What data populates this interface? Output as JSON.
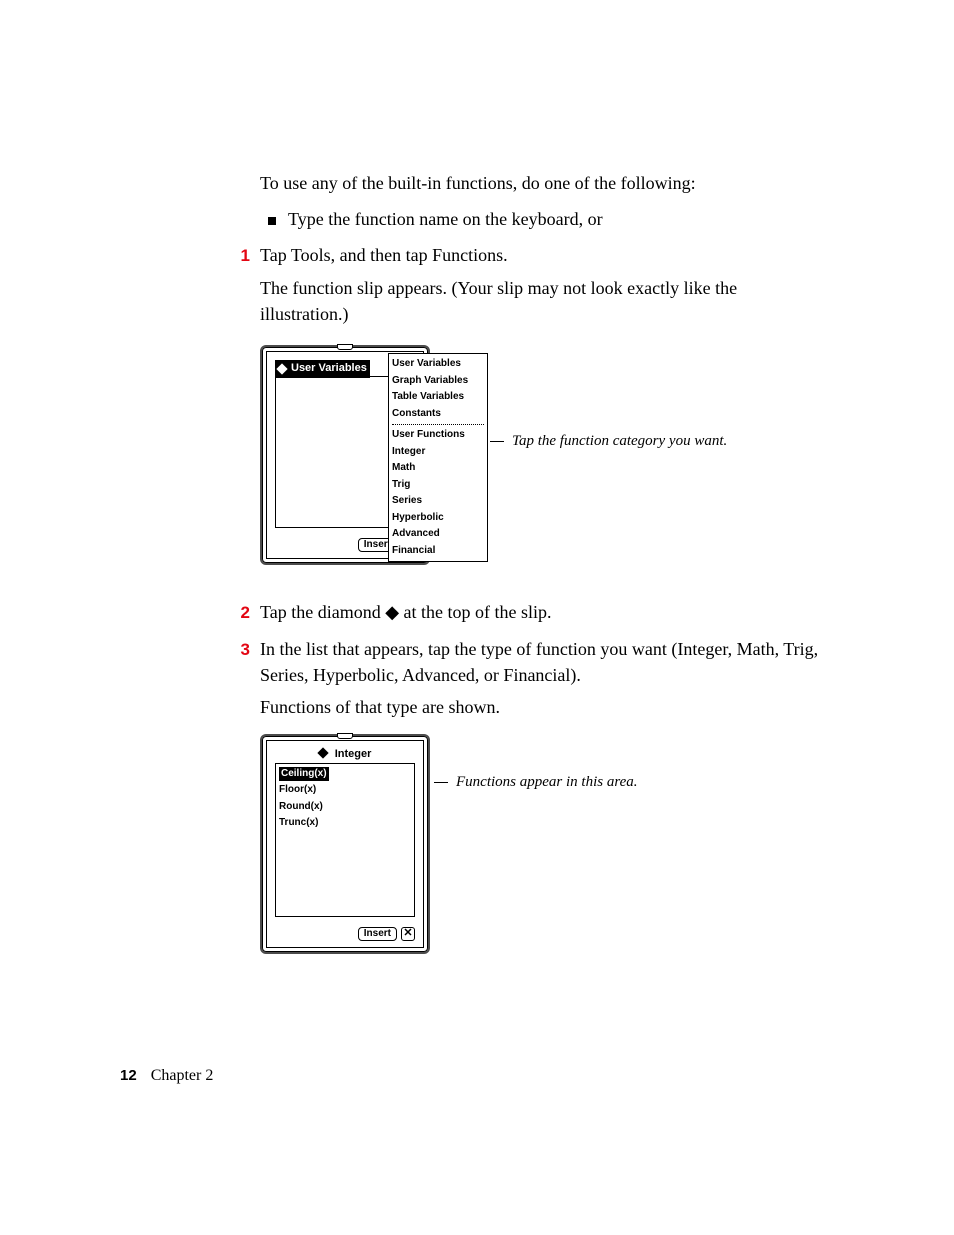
{
  "intro": "To use any of the built-in functions, do one of the following:",
  "bullet1": "Type the function name on the keyboard, or",
  "step1": "Tap Tools, and then tap Functions.",
  "step1_followup": "The function slip appears. (Your slip may not look exactly like the illustration.)",
  "fig1": {
    "header_label": "User Variables",
    "dropdown_group1": [
      "User Variables",
      "Graph Variables",
      "Table Variables",
      "Constants"
    ],
    "dropdown_group2": [
      "User Functions",
      "Integer",
      "Math",
      "Trig",
      "Series",
      "Hyperbolic",
      "Advanced",
      "Financial"
    ],
    "insert_label": "Insert",
    "close_glyph": "✕",
    "callout": "Tap the function category you want."
  },
  "step2": "Tap the diamond ◆ at the top of the slip.",
  "step3": "In the list that appears, tap the type of function you want (Integer, Math, Trig, Series, Hyperbolic, Advanced, or Financial).",
  "step3_followup": "Functions of that type are shown.",
  "fig2": {
    "header_label": "Integer",
    "items": [
      "Ceiling(x)",
      "Floor(x)",
      "Round(x)",
      "Trunc(x)"
    ],
    "insert_label": "Insert",
    "close_glyph": "✕",
    "callout": "Functions appear in this area."
  },
  "footer": {
    "page": "12",
    "chapter": "Chapter 2"
  },
  "numbers": {
    "one": "1",
    "two": "2",
    "three": "3"
  }
}
